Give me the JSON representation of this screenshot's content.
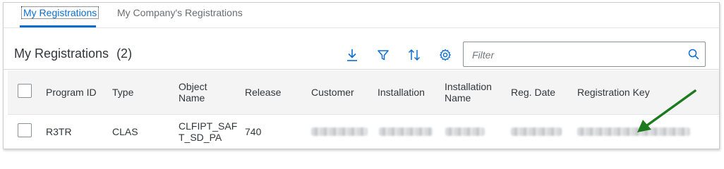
{
  "tabs": [
    {
      "label": "My Registrations"
    },
    {
      "label": "My Company's Registrations"
    }
  ],
  "toolbar": {
    "title": "My Registrations",
    "count": "(2)",
    "icons": [
      "download-icon",
      "filter-icon",
      "sort-icon",
      "settings-icon"
    ],
    "accent": "#0a6ed1"
  },
  "search": {
    "placeholder": "Filter",
    "value": ""
  },
  "table": {
    "columns": [
      {
        "label": "Program ID"
      },
      {
        "label": "Type"
      },
      {
        "label": "Object\nName"
      },
      {
        "label": "Release"
      },
      {
        "label": "Customer"
      },
      {
        "label": "Installation"
      },
      {
        "label": "Installation\nName"
      },
      {
        "label": "Reg. Date"
      },
      {
        "label": "Registration Key"
      }
    ],
    "rows": [
      {
        "program_id": "R3TR",
        "type": "CLAS",
        "object_name": "CLFIPT_SAF\nT_SD_PA",
        "release": "740"
      }
    ]
  },
  "annotation": {
    "color": "#1e7a1e"
  }
}
